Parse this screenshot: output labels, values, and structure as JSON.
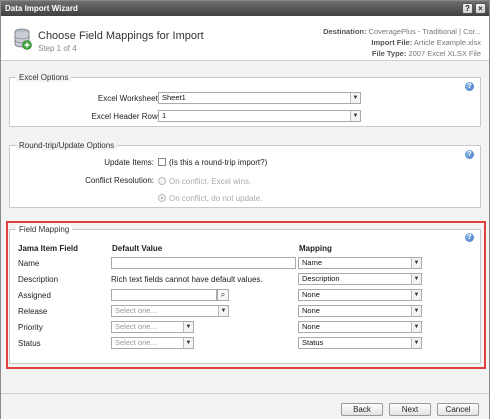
{
  "window": {
    "title": "Data Import Wizard",
    "help_glyph": "?",
    "close_glyph": "×"
  },
  "header": {
    "title": "Choose Field Mappings for Import",
    "step": "Step 1 of 4",
    "destination_label": "Destination:",
    "destination_value": "CoveragePlus - Traditional | Cor...",
    "import_file_label": "Import File:",
    "import_file_value": "Article Example.xlsx",
    "file_type_label": "File Type:",
    "file_type_value": "2007 Excel XLSX File"
  },
  "excel_options": {
    "title": "Excel Options",
    "worksheet_label": "Excel Worksheet:",
    "worksheet_value": "Sheet1",
    "header_row_label": "Excel Header Row:",
    "header_row_value": "1"
  },
  "roundtrip": {
    "title": "Round-trip/Update Options",
    "update_items_label": "Update Items:",
    "update_items_text": "(Is this a round-trip import?)",
    "conflict_label": "Conflict Resolution:",
    "option_excel_wins": "On conflict, Excel wins.",
    "option_no_update": "On conflict, do not update."
  },
  "field_mapping": {
    "title": "Field Mapping",
    "col_field": "Jama Item Field",
    "col_default": "Default Value",
    "col_mapping": "Mapping",
    "rows": [
      {
        "field": "Name",
        "default": "",
        "mapping": "Name"
      },
      {
        "field": "Description",
        "default": "Rich text fields cannot have default values.",
        "mapping": "Description"
      },
      {
        "field": "Assigned",
        "default": "",
        "mapping": "None"
      },
      {
        "field": "Release",
        "default": "Select one...",
        "mapping": "None"
      },
      {
        "field": "Priority",
        "default": "Select one...",
        "mapping": "None"
      },
      {
        "field": "Status",
        "default": "Select one...",
        "mapping": "Status"
      }
    ]
  },
  "footer": {
    "back": "Back",
    "next": "Next",
    "cancel": "Cancel"
  },
  "icons": {
    "help": "help-icon",
    "dropdown": "chevron-down-icon",
    "search": "search-icon",
    "database": "database-add-icon"
  },
  "colors": {
    "highlight": "#e04040",
    "titlebar": "#4a4a4a"
  }
}
